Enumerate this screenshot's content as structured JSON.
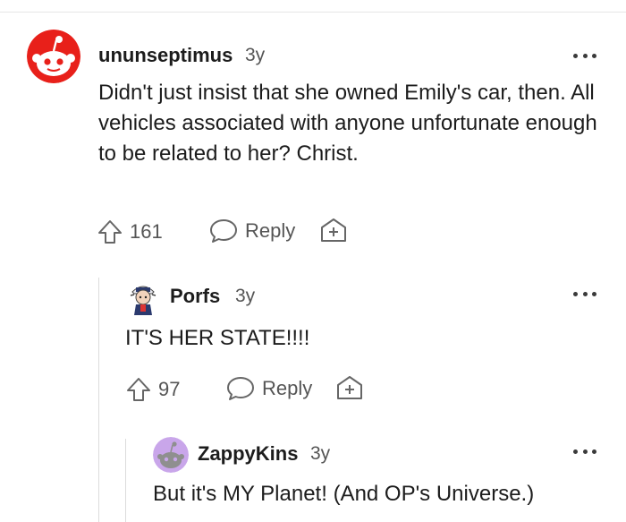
{
  "comments": [
    {
      "username": "ununseptimus",
      "age": "3y",
      "body": "Didn't just insist that she owned Emily's car, then. All vehicles associated with anyone unfortunate enough to be related to her? Christ.",
      "score": "161",
      "reply_label": "Reply",
      "avatar_icon": "reddit-snoo-red-icon"
    },
    {
      "username": "Porfs",
      "age": "3y",
      "body": "IT'S HER STATE!!!!",
      "score": "97",
      "reply_label": "Reply",
      "avatar_icon": "custom-avatar-icon"
    },
    {
      "username": "ZappyKins",
      "age": "3y",
      "body": "But it's MY Planet! (And OP's Universe.)",
      "avatar_icon": "reddit-snoo-purple-icon"
    }
  ],
  "colors": {
    "red_avatar": "#e8201a",
    "purple_avatar": "#c9a6ea",
    "text": "#1c1c1c",
    "muted": "#555555"
  }
}
